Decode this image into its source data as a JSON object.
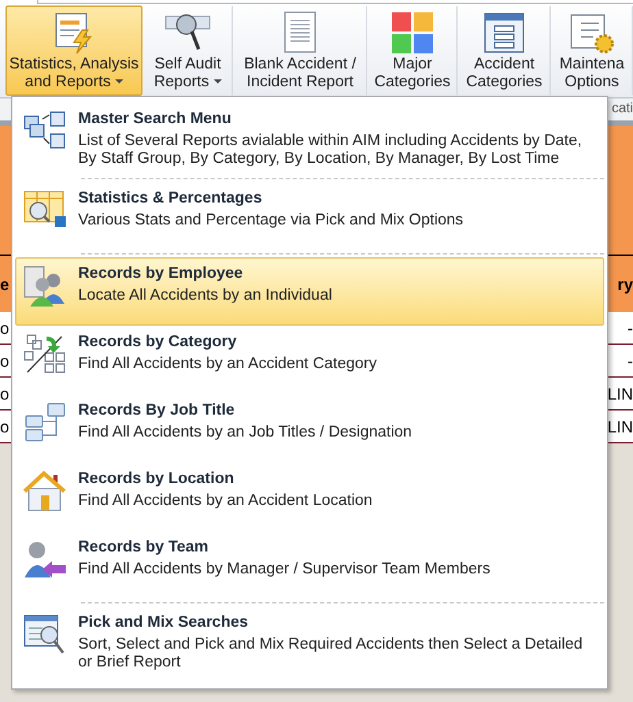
{
  "ribbon": {
    "buttons": [
      {
        "lines": [
          "Statistics, Analysis",
          "and Reports"
        ],
        "dropdown": true,
        "selected": true
      },
      {
        "lines": [
          "Self Audit",
          "Reports"
        ],
        "dropdown": true,
        "selected": false
      },
      {
        "lines": [
          "Blank Accident /",
          "Incident Report"
        ],
        "dropdown": false,
        "selected": false
      },
      {
        "lines": [
          "Major",
          "Categories"
        ],
        "dropdown": false,
        "selected": false
      },
      {
        "lines": [
          "Accident",
          "Categories"
        ],
        "dropdown": false,
        "selected": false
      },
      {
        "lines": [
          "Maintena",
          "Options"
        ],
        "dropdown": false,
        "selected": false
      }
    ],
    "group_label": "cati"
  },
  "background": {
    "header_left": "e",
    "header_right": "ry",
    "rows": [
      {
        "left": "o",
        "right": "-"
      },
      {
        "left": "o",
        "right": "-"
      },
      {
        "left": "o",
        "right": "LIN"
      },
      {
        "left": "o",
        "right": "LIN"
      }
    ]
  },
  "menu": {
    "items": [
      {
        "title": "Master Search Menu",
        "description": "List of Several Reports avialable within AIM including Accidents by Date, By Staff Group, By Category, By Location, By Manager, By Lost Time",
        "selected": false,
        "separator_after": true
      },
      {
        "title": "Statistics & Percentages",
        "description": "Various Stats and Percentage via Pick and Mix Options",
        "selected": false,
        "separator_after": true
      },
      {
        "title": "Records by Employee",
        "description": "Locate All Accidents by an Individual",
        "selected": true,
        "separator_after": false
      },
      {
        "title": "Records by Category",
        "description": "Find All Accidents by an Accident Category",
        "selected": false,
        "separator_after": false
      },
      {
        "title": "Records By Job Title",
        "description": "Find All Accidents by an Job Titles / Designation",
        "selected": false,
        "separator_after": false
      },
      {
        "title": "Records by Location",
        "description": "Find All Accidents by an Accident Location",
        "selected": false,
        "separator_after": false
      },
      {
        "title": "Records by Team",
        "description": "Find All Accidents by Manager / Supervisor Team Members",
        "selected": false,
        "separator_after": true
      },
      {
        "title": "Pick and Mix Searches",
        "description": "Sort, Select and Pick and Mix Required Accidents then Select a Detailed or Brief Report",
        "selected": false,
        "separator_after": false
      }
    ]
  }
}
